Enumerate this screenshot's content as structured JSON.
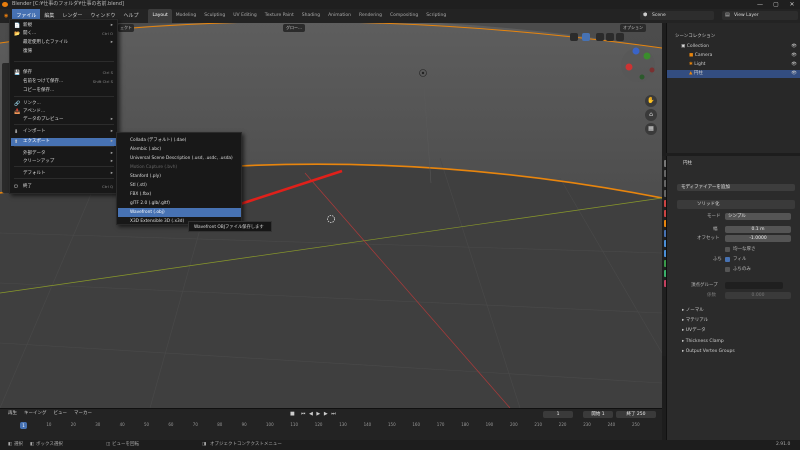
{
  "title_bar": {
    "title": "Blender [C:¥仕事のフォルダ¥仕事の名前.blend]",
    "minimize": "—",
    "maximize": "▢",
    "close": "✕"
  },
  "menus": [
    "ファイル",
    "編集",
    "レンダー",
    "ウィンドウ",
    "ヘルプ"
  ],
  "workspace_tabs": [
    "Layout",
    "Modeling",
    "Sculpting",
    "UV Editing",
    "Texture Paint",
    "Shading",
    "Animation",
    "Rendering",
    "Compositing",
    "Scripting"
  ],
  "scene_field": "Scene",
  "view_layer_field": "View Layer",
  "viewport": {
    "header_global": "グロー…",
    "options": "オプション",
    "mode_label_partial": "ェクト"
  },
  "file_menu": [
    {
      "label": "新規",
      "shortcut": "Ctrl N",
      "arrow": "▸",
      "icon": "📄"
    },
    {
      "label": "開く...",
      "shortcut": "Ctrl O",
      "icon": "📂"
    },
    {
      "label": "最近使用したファイル",
      "shortcut": "Shift Ctrl O",
      "arrow": "▸"
    },
    {
      "label": "復帰",
      "shortcut": ""
    },
    {
      "label": "保存",
      "shortcut": "Ctrl S",
      "icon": "💾"
    },
    {
      "label": "名前をつけて保存...",
      "shortcut": "Shift Ctrl S"
    },
    {
      "label": "コピーを保存...",
      "shortcut": ""
    },
    {
      "label": "リンク...",
      "shortcut": "",
      "icon": "🔗"
    },
    {
      "label": "アペンド...",
      "shortcut": "",
      "icon": "📥"
    },
    {
      "label": "データのプレビュー",
      "shortcut": "",
      "arrow": "▸"
    },
    {
      "label": "インポート",
      "shortcut": "",
      "arrow": "▸",
      "icon": "⬇"
    },
    {
      "label": "エクスポート",
      "shortcut": "",
      "arrow": "▸",
      "icon": "⬆"
    },
    {
      "label": "外部データ",
      "shortcut": "",
      "arrow": "▸"
    },
    {
      "label": "クリーンアップ",
      "shortcut": "",
      "arrow": "▸"
    },
    {
      "label": "デフォルト",
      "shortcut": "",
      "arrow": "▸"
    },
    {
      "label": "終了",
      "shortcut": "Ctrl Q",
      "icon": "⏻"
    }
  ],
  "export_menu": [
    "Collada (デフォルト) (.dae)",
    "Alembic (.abc)",
    "Universal Scene Description (.usd, .usdc, .usda)",
    "Motion Capture (.bvh)",
    "Stanford (.ply)",
    "Stl (.stl)",
    "FBX (.fbx)",
    "glTF 2.0 (.glb/.gltf)",
    "Wavefront (.obj)",
    "X3D Extensible 3D (.x3d)"
  ],
  "tooltip": "Wavefront OBJファイル保存します",
  "outliner": {
    "header": "シーンコレクション",
    "rows": [
      "Collection",
      "Camera",
      "Light",
      "円柱"
    ]
  },
  "properties": {
    "object_name": "円柱",
    "add_modifier": "モディファイアーを追加",
    "modifier_name": "ソリッド化",
    "mode_label": "モード",
    "mode_value": "シンプル",
    "thickness_label": "幅",
    "thickness_value": "0.1 m",
    "offset_label": "オフセット",
    "offset_value": "-1.0000",
    "even_label": "均一な厚さ",
    "rim_label": "ふち",
    "rim_value": "フィル",
    "rim_only_label": "ふちのみ",
    "vgroup_label": "頂点グループ",
    "factor_label": "係数",
    "factor_value": "0.000",
    "sections": [
      "ノーマル",
      "マテリアル",
      "UVデータ",
      "Thickness Clamp",
      "Output Vertex Groups"
    ]
  },
  "timeline": {
    "menus": [
      "再生",
      "キーイング",
      "ビュー",
      "マーカー"
    ],
    "current_frame": "1",
    "start_label": "開始",
    "start_value": "1",
    "end_label": "終了",
    "end_value": "250",
    "ticks": [
      "0",
      "10",
      "20",
      "30",
      "40",
      "50",
      "60",
      "70",
      "80",
      "90",
      "100",
      "110",
      "120",
      "130",
      "140",
      "150",
      "160",
      "170",
      "180",
      "190",
      "200",
      "210",
      "220",
      "230",
      "240",
      "250"
    ]
  },
  "status_bar": {
    "left1": "選択",
    "left2": "ボックス選択",
    "middle1": "ビューを回転",
    "right1": "オブジェクトコンテクストメニュー",
    "version": "2.91.0"
  },
  "colors": {
    "accent": "#4772b3",
    "arrow": "#e0201a",
    "outline": "#e8850d"
  }
}
